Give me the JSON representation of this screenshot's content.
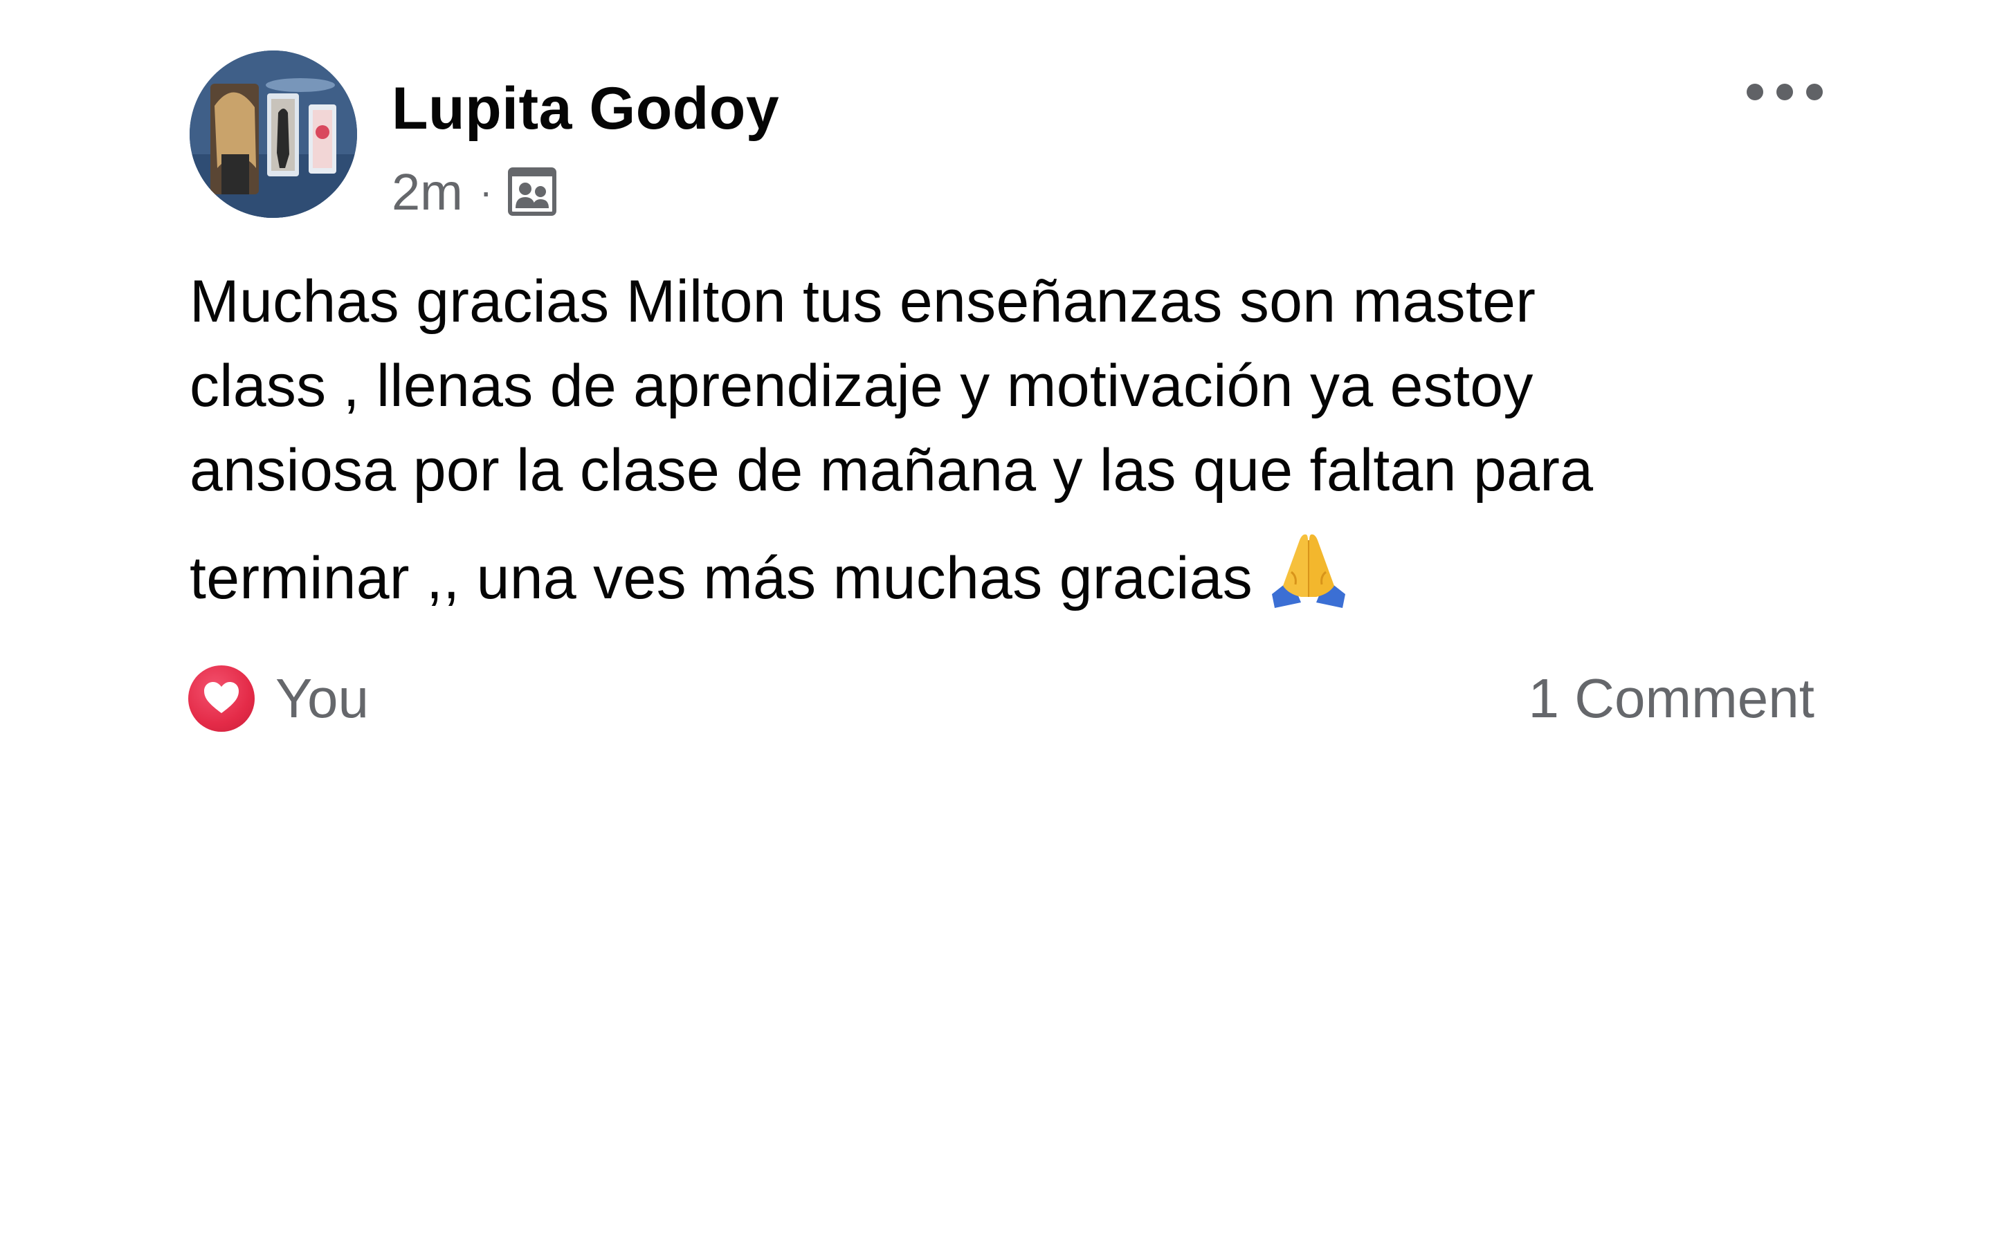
{
  "post": {
    "author_name": "Lupita Godoy",
    "timestamp": "2m",
    "separator": "·",
    "audience_icon": "group-icon",
    "more_icon": "more-options-icon",
    "text_lines": [
      "Muchas gracias Milton tus enseñanzas son master",
      "class , llenas de aprendizaje y motivación ya estoy",
      "ansiosa por la clase de mañana y las que faltan para",
      "terminar ,, una ves más muchas gracias"
    ],
    "emoji": "folded-hands-icon",
    "reaction": {
      "icon": "heart-reaction-icon",
      "label": "You"
    },
    "comments_label": "1 Comment"
  },
  "colors": {
    "text_primary": "#050505",
    "text_secondary": "#65676b",
    "heart_red": "#e42b48",
    "background": "#ffffff"
  }
}
